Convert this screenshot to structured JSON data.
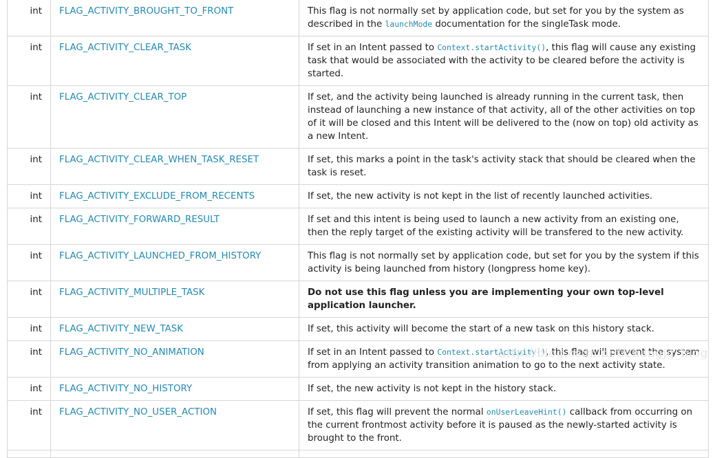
{
  "rows": [
    {
      "type": "int",
      "name": "FLAG_ACTIVITY_BROUGHT_TO_FRONT",
      "desc": {
        "pre": "This flag is not normally set by application code, but set for you by the system as described in the ",
        "code": "launchMode",
        "post": " documentation for the singleTask mode."
      }
    },
    {
      "type": "int",
      "name": "FLAG_ACTIVITY_CLEAR_TASK",
      "desc": {
        "pre": "If set in an Intent passed to ",
        "code": "Context.startActivity()",
        "post": ", this flag will cause any existing task that would be associated with the activity to be cleared before the activity is started."
      }
    },
    {
      "type": "int",
      "name": "FLAG_ACTIVITY_CLEAR_TOP",
      "desc": {
        "pre": "If set, and the activity being launched is already running in the current task, then instead of launching a new instance of that activity, all of the other activities on top of it will be closed and this Intent will be delivered to the (now on top) old activity as a new Intent.",
        "code": "",
        "post": ""
      }
    },
    {
      "type": "int",
      "name": "FLAG_ACTIVITY_CLEAR_WHEN_TASK_RESET",
      "desc": {
        "pre": "If set, this marks a point in the task's activity stack that should be cleared when the task is reset.",
        "code": "",
        "post": ""
      }
    },
    {
      "type": "int",
      "name": "FLAG_ACTIVITY_EXCLUDE_FROM_RECENTS",
      "desc": {
        "pre": "If set, the new activity is not kept in the list of recently launched activities.",
        "code": "",
        "post": ""
      }
    },
    {
      "type": "int",
      "name": "FLAG_ACTIVITY_FORWARD_RESULT",
      "desc": {
        "pre": "If set and this intent is being used to launch a new activity from an existing one, then the reply target of the existing activity will be transfered to the new activity.",
        "code": "",
        "post": ""
      }
    },
    {
      "type": "int",
      "name": "FLAG_ACTIVITY_LAUNCHED_FROM_HISTORY",
      "desc": {
        "pre": "This flag is not normally set by application code, but set for you by the system if this activity is being launched from history (longpress home key).",
        "code": "",
        "post": ""
      }
    },
    {
      "type": "int",
      "name": "FLAG_ACTIVITY_MULTIPLE_TASK",
      "desc": {
        "pre": "",
        "code": "",
        "post": "",
        "bold": "Do not use this flag unless you are implementing your own top-level application launcher."
      }
    },
    {
      "type": "int",
      "name": "FLAG_ACTIVITY_NEW_TASK",
      "desc": {
        "pre": "If set, this activity will become the start of a new task on this history stack.",
        "code": "",
        "post": ""
      }
    },
    {
      "type": "int",
      "name": "FLAG_ACTIVITY_NO_ANIMATION",
      "desc": {
        "pre": "If set in an Intent passed to ",
        "code": "Context.startActivity()",
        "post": ", this flag will prevent the system from applying an activity transition animation to go to the next activity state."
      }
    },
    {
      "type": "int",
      "name": "FLAG_ACTIVITY_NO_HISTORY",
      "desc": {
        "pre": "If set, the new activity is not kept in the history stack.",
        "code": "",
        "post": ""
      }
    },
    {
      "type": "int",
      "name": "FLAG_ACTIVITY_NO_USER_ACTION",
      "desc": {
        "pre": "If set, this flag will prevent the normal ",
        "code": "onUserLeaveHint()",
        "post": " callback from occurring on the current frontmost activity before it is paused as the newly-started activity is brought to the front."
      }
    }
  ],
  "watermark": "http://blog.csdn.net/zhangjg_blog",
  "colors": {
    "link": "#258aaf",
    "border": "#d6d6d6",
    "text": "#222222"
  }
}
